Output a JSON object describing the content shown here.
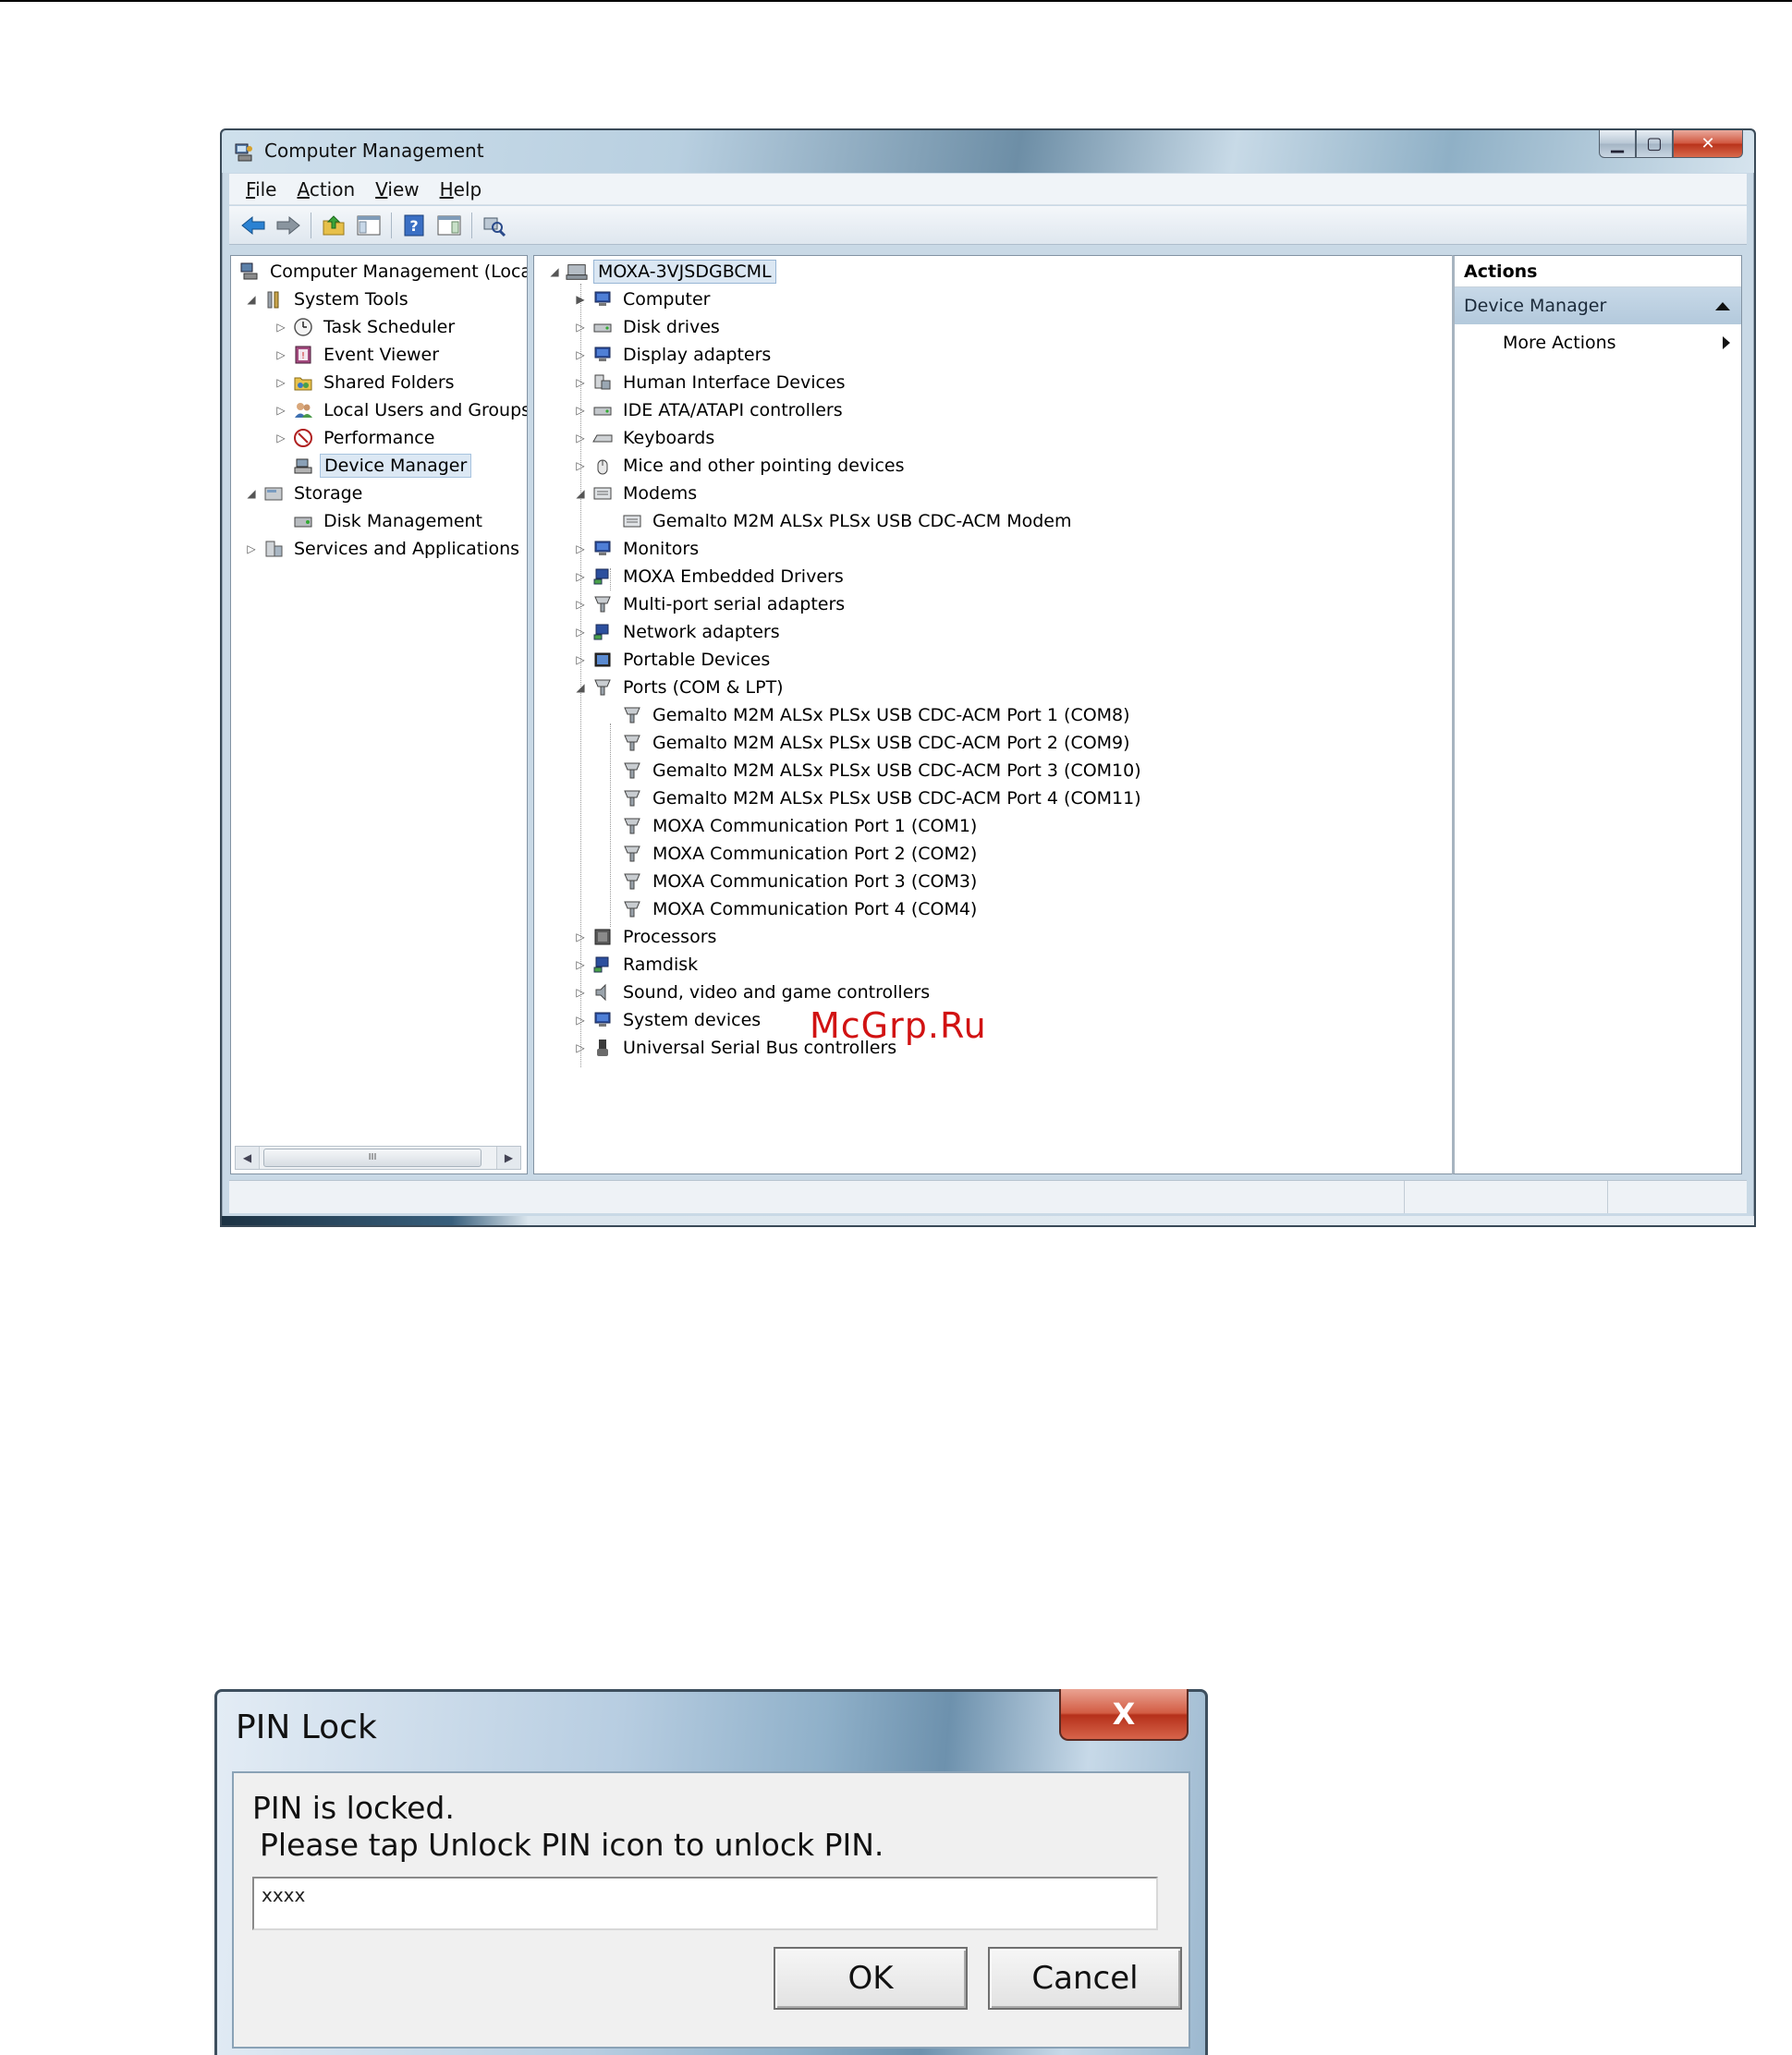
{
  "cm_window": {
    "title": "Computer Management",
    "menu": [
      {
        "hot": "F",
        "rest": "ile"
      },
      {
        "hot": "A",
        "rest": "ction"
      },
      {
        "hot": "V",
        "rest": "iew"
      },
      {
        "hot": "H",
        "rest": "elp"
      }
    ],
    "left_tree": {
      "root": "Computer Management (Local",
      "system_tools": "System Tools",
      "task_scheduler": "Task Scheduler",
      "event_viewer": "Event Viewer",
      "shared_folders": "Shared Folders",
      "local_users": "Local Users and Groups",
      "performance": "Performance",
      "device_manager": "Device Manager",
      "storage": "Storage",
      "disk_management": "Disk Management",
      "services": "Services and Applications",
      "scroll_grip": "III"
    },
    "device_tree": {
      "root": "MOXA-3VJSDGBCML",
      "categories": [
        "Computer",
        "Disk drives",
        "Display adapters",
        "Human Interface Devices",
        "IDE ATA/ATAPI controllers",
        "Keyboards",
        "Mice and other pointing devices",
        "Modems",
        "Gemalto M2M ALSx PLSx USB CDC-ACM Modem",
        "Monitors",
        "MOXA Embedded Drivers",
        "Multi-port serial adapters",
        "Network adapters",
        "Portable Devices",
        "Ports (COM & LPT)",
        "Gemalto M2M ALSx PLSx USB CDC-ACM Port 1 (COM8)",
        "Gemalto M2M ALSx PLSx USB CDC-ACM Port 2 (COM9)",
        "Gemalto M2M ALSx PLSx USB CDC-ACM Port 3 (COM10)",
        "Gemalto M2M ALSx PLSx USB CDC-ACM Port 4 (COM11)",
        "MOXA Communication Port 1 (COM1)",
        "MOXA Communication Port 2 (COM2)",
        "MOXA Communication Port 3 (COM3)",
        "MOXA Communication Port 4 (COM4)",
        "Processors",
        "Ramdisk",
        "Sound, video and game controllers",
        "System devices",
        "Universal Serial Bus controllers"
      ]
    },
    "actions": {
      "header": "Actions",
      "section": "Device Manager",
      "more": "More Actions"
    }
  },
  "watermark": "McGrp.Ru",
  "pin_dialog": {
    "title": "PIN Lock",
    "close": "X",
    "message_line1": "PIN is locked.",
    "message_line2": "Please tap Unlock PIN icon to unlock PIN.",
    "input_value": "xxxx",
    "ok_label": "OK",
    "cancel_label": "Cancel"
  },
  "colors": {
    "watermark": "#d11212",
    "selection": "#dce8f4",
    "close_button": "#c8452c"
  }
}
